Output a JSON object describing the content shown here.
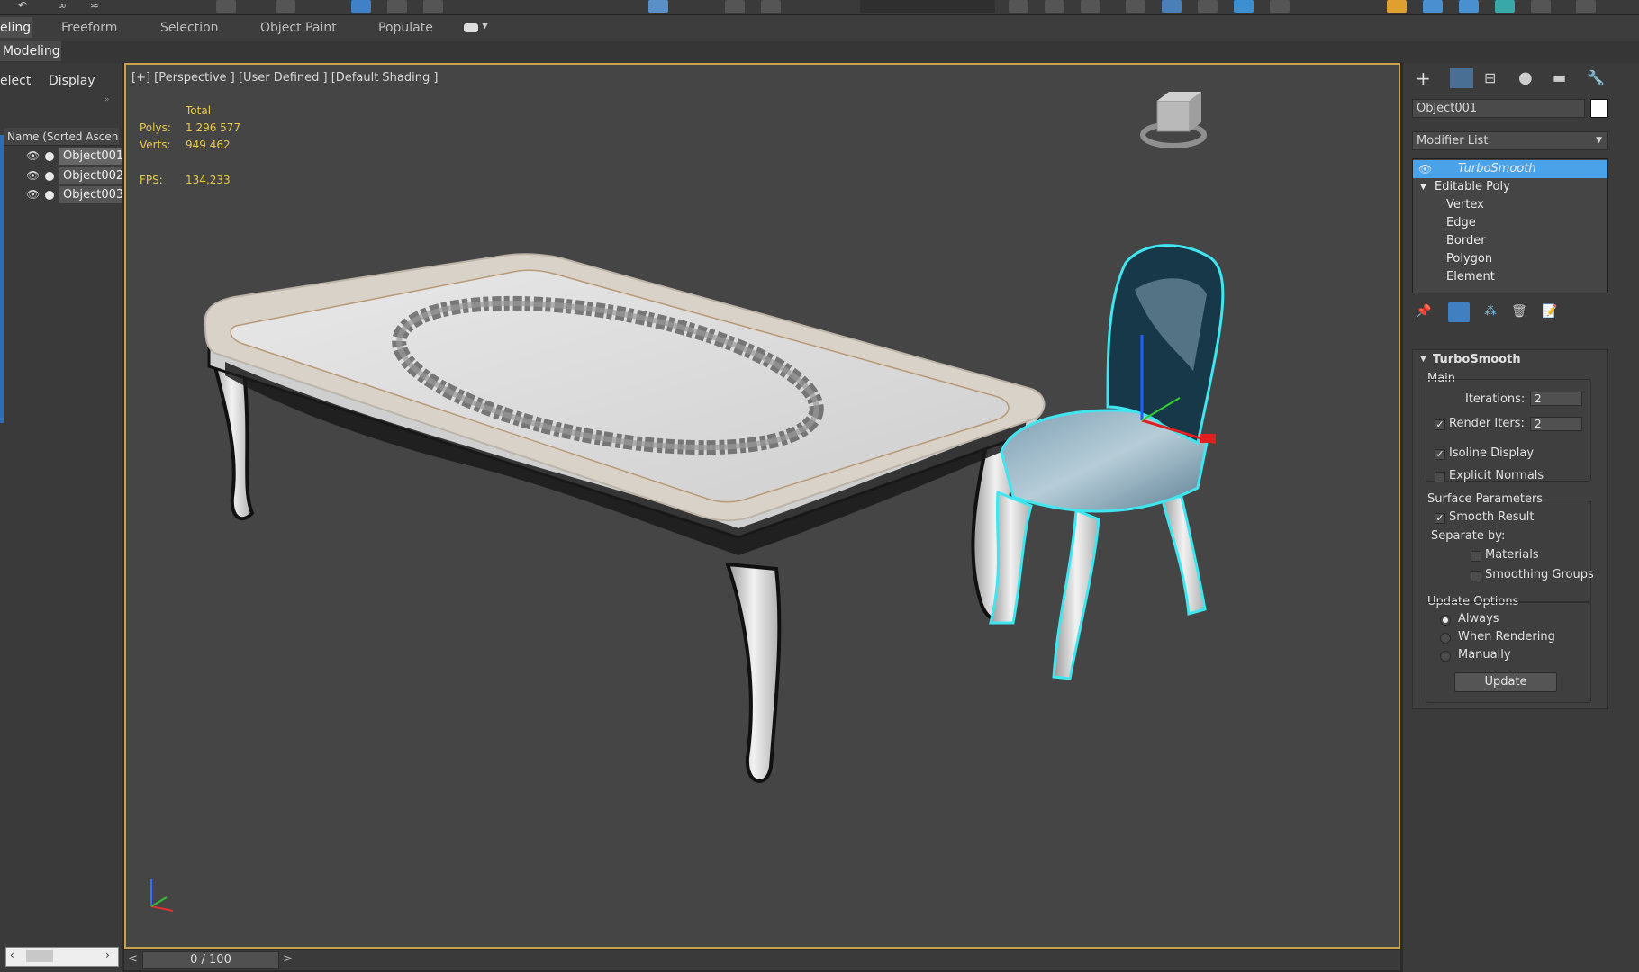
{
  "ribbon": {
    "tabs": [
      "eling",
      "Freeform",
      "Selection",
      "Object Paint",
      "Populate"
    ],
    "sub_label": "Modeling"
  },
  "scene_explorer": {
    "tabs": [
      "elect",
      "Display"
    ],
    "column_header": "Name (Sorted Ascen",
    "objects": [
      "Object001",
      "Object002",
      "Object003"
    ]
  },
  "viewport": {
    "label": "[+] [Perspective ] [User Defined ] [Default Shading ]",
    "stats": {
      "total_label": "Total",
      "polys_label": "Polys:",
      "polys_value": "1 296 577",
      "verts_label": "Verts:",
      "verts_value": "949 462",
      "fps_label": "FPS:",
      "fps_value": "134,233"
    }
  },
  "timeline": {
    "frame": "0 / 100"
  },
  "command_panel": {
    "object_name": "Object001",
    "modifier_list": "Modifier List",
    "stack": [
      {
        "label": "TurboSmooth"
      },
      {
        "label": "Editable Poly"
      },
      {
        "label": "Vertex"
      },
      {
        "label": "Edge"
      },
      {
        "label": "Border"
      },
      {
        "label": "Polygon"
      },
      {
        "label": "Element"
      }
    ],
    "turbosmooth": {
      "title": "TurboSmooth",
      "main_label": "Main",
      "iterations_label": "Iterations:",
      "iterations_value": "2",
      "render_iters_label": "Render Iters:",
      "render_iters_value": "2",
      "isoline_label": "Isoline Display",
      "explicit_normals_label": "Explicit Normals",
      "surface_params_label": "Surface Parameters",
      "smooth_result_label": "Smooth Result",
      "separate_by_label": "Separate by:",
      "materials_label": "Materials",
      "smoothing_groups_label": "Smoothing Groups",
      "update_options_label": "Update Options",
      "always_label": "Always",
      "when_rendering_label": "When Rendering",
      "manually_label": "Manually",
      "update_button": "Update"
    }
  },
  "colors": {
    "viewport_border": "#c8a14c",
    "stats_text": "#e8c94a",
    "selection_highlight": "#4aa3e8",
    "selection_outline": "#3fe6f0"
  }
}
